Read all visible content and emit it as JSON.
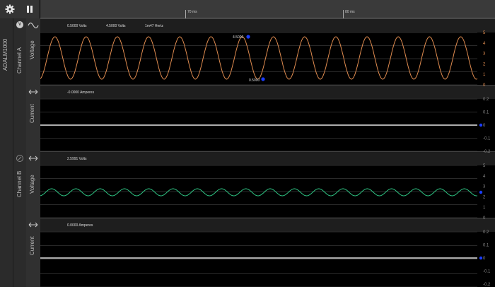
{
  "toolbar": {
    "settings_icon": "gear-icon",
    "pause_icon": "pause-icon"
  },
  "timebar": {
    "ticks": [
      "70 ms",
      "80 ms"
    ]
  },
  "device": {
    "name": "ADALM1000"
  },
  "channel_a": {
    "label": "Channel A",
    "badge": "V",
    "voltage": {
      "label": "Voltage",
      "readouts": [
        "0.5000 Volts",
        "4.5000 Volts",
        "1m47 Hertz"
      ],
      "marker_max": "4.5000",
      "marker_min": "0.5000",
      "ticks": [
        "5",
        "4",
        "3",
        "2",
        "1",
        "0"
      ],
      "color": "#e08c50"
    },
    "current": {
      "label": "Current",
      "readout": "-0.0000 Amperes",
      "ticks": [
        "0.2",
        "0.1",
        "0",
        "-0.1",
        "-0.2"
      ]
    }
  },
  "channel_b": {
    "label": "Channel B",
    "voltage": {
      "label": "Voltage",
      "readout": "2.5991 Volts",
      "ticks": [
        "5",
        "4",
        "3",
        "2",
        "1",
        "0"
      ],
      "color": "#2ec483"
    },
    "current": {
      "label": "Current",
      "readout": "0.0000 Amperes",
      "ticks": [
        "0.2",
        "0.1",
        "0",
        "-0.1",
        "-0.2"
      ]
    }
  }
}
